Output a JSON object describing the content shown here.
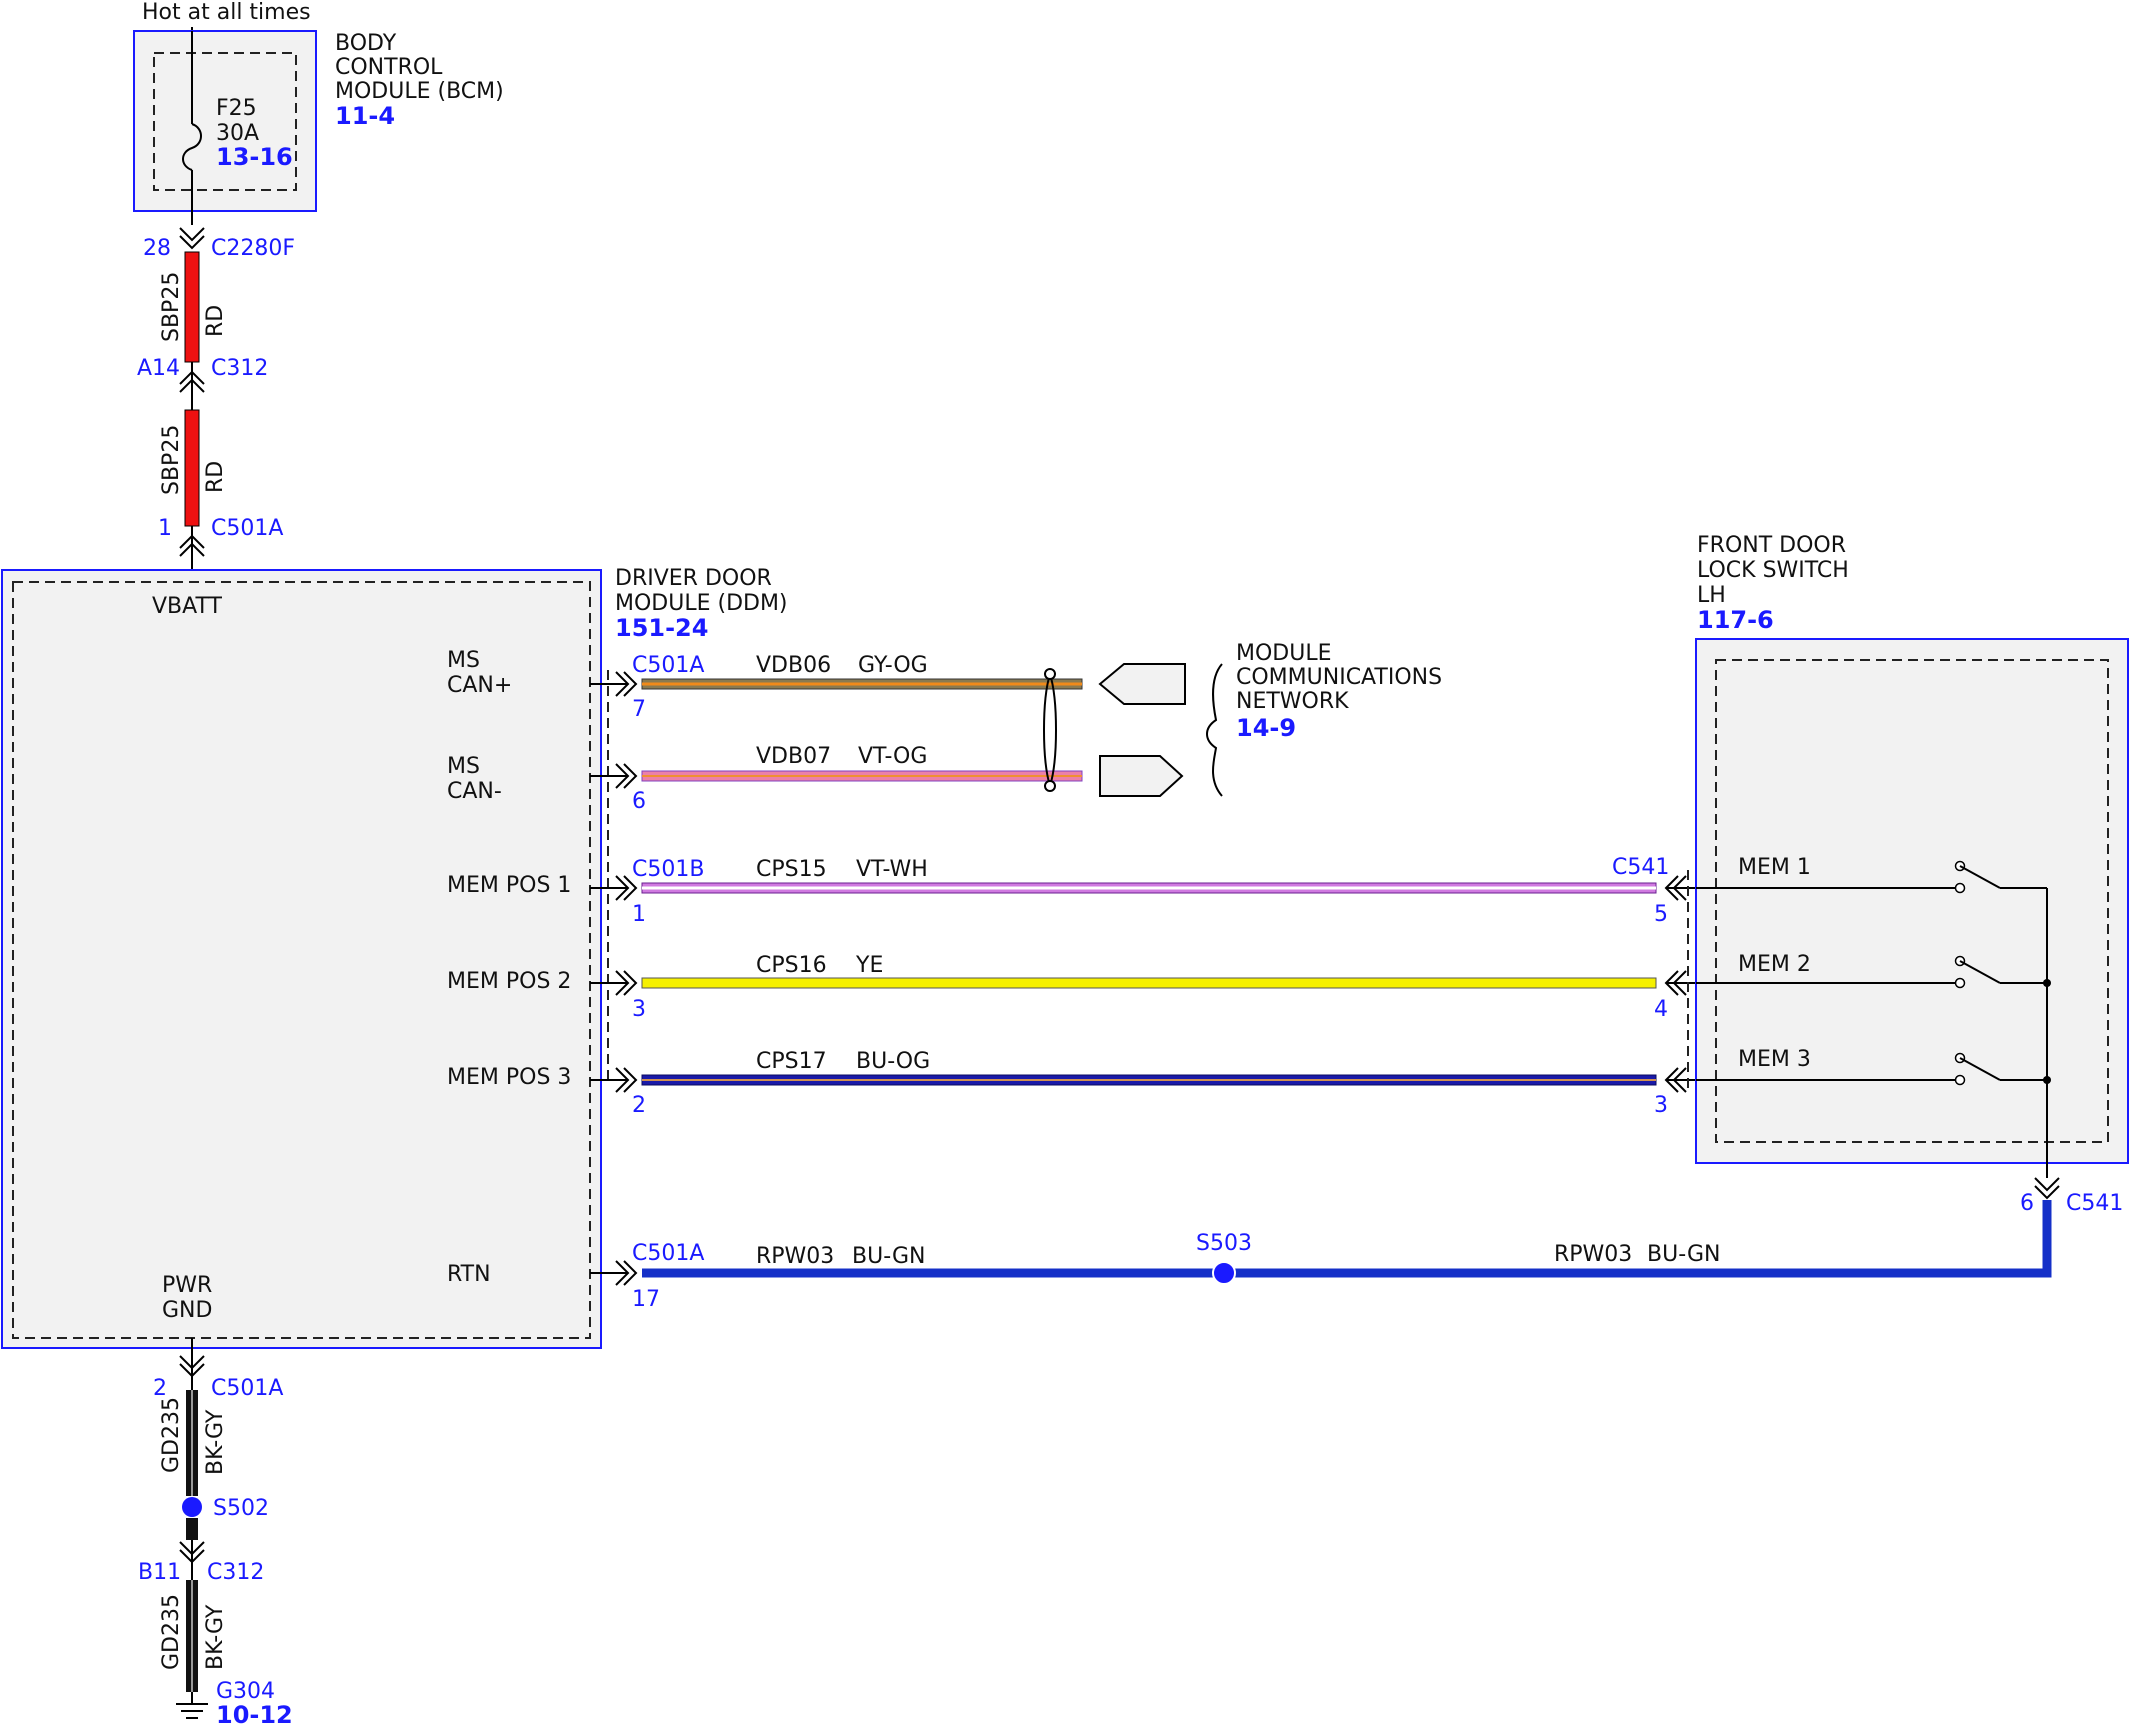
{
  "power": {
    "hot_label": "Hot at all times",
    "fuse_name": "F25",
    "fuse_rating": "30A",
    "fuse_ref": "13-16"
  },
  "bcm": {
    "line1": "BODY",
    "line2": "CONTROL",
    "line3": "MODULE (BCM)",
    "ref": "11-4"
  },
  "supply": {
    "pin_top": "28",
    "conn_top": "C2280F",
    "circuit": "SBP25",
    "color": "RD",
    "pin_mid": "A14",
    "conn_mid": "C312",
    "pin_bot": "1",
    "conn_bot": "C501A"
  },
  "ddm": {
    "line1": "DRIVER DOOR",
    "line2": "MODULE (DDM)",
    "ref": "151-24",
    "vbatt": "VBATT",
    "pwr": "PWR",
    "gnd": "GND",
    "can_plus_1": "MS",
    "can_plus_2": "CAN+",
    "can_minus_1": "MS",
    "can_minus_2": "CAN-",
    "mem1": "MEM POS 1",
    "mem2": "MEM POS 2",
    "mem3": "MEM POS 3",
    "rtn": "RTN"
  },
  "network": {
    "line1": "MODULE",
    "line2": "COMMUNICATIONS",
    "line3": "NETWORK",
    "ref": "14-9"
  },
  "wires": {
    "can_plus": {
      "conn": "C501A",
      "pin": "7",
      "circuit": "VDB06",
      "color": "GY-OG"
    },
    "can_minus": {
      "pin": "6",
      "circuit": "VDB07",
      "color": "VT-OG"
    },
    "mem1": {
      "conn": "C501B",
      "pin": "1",
      "circuit": "CPS15",
      "color": "VT-WH",
      "conn_right": "C541",
      "pin_right": "5"
    },
    "mem2": {
      "pin": "3",
      "circuit": "CPS16",
      "color": "YE",
      "pin_right": "4"
    },
    "mem3": {
      "pin": "2",
      "circuit": "CPS17",
      "color": "BU-OG",
      "pin_right": "3"
    },
    "rtn": {
      "conn": "C501A",
      "pin": "17",
      "circuit": "RPW03",
      "color": "BU-GN",
      "splice": "S503",
      "circuit_right": "RPW03",
      "color_right": "BU-GN"
    }
  },
  "switch": {
    "line1": "FRONT DOOR",
    "line2": "LOCK SWITCH",
    "line3": "LH",
    "ref": "117-6",
    "mem1": "MEM 1",
    "mem2": "MEM 2",
    "mem3": "MEM 3",
    "out_pin": "6",
    "out_conn": "C541"
  },
  "ground": {
    "pin1": "2",
    "conn1": "C501A",
    "circuit": "GD235",
    "color": "BK-GY",
    "splice": "S502",
    "pin2": "B11",
    "conn2": "C312",
    "ground_name": "G304",
    "ground_ref": "10-12"
  },
  "colors": {
    "red": "#ee1111",
    "blue_label": "#1a1aff",
    "wire_blue": "#1530c8",
    "yellow": "#f5f000",
    "pink": "#ec80a8",
    "violet": "#a040d0",
    "gray_orange": "#8a7a50",
    "box_fill": "#f2f2f2"
  }
}
